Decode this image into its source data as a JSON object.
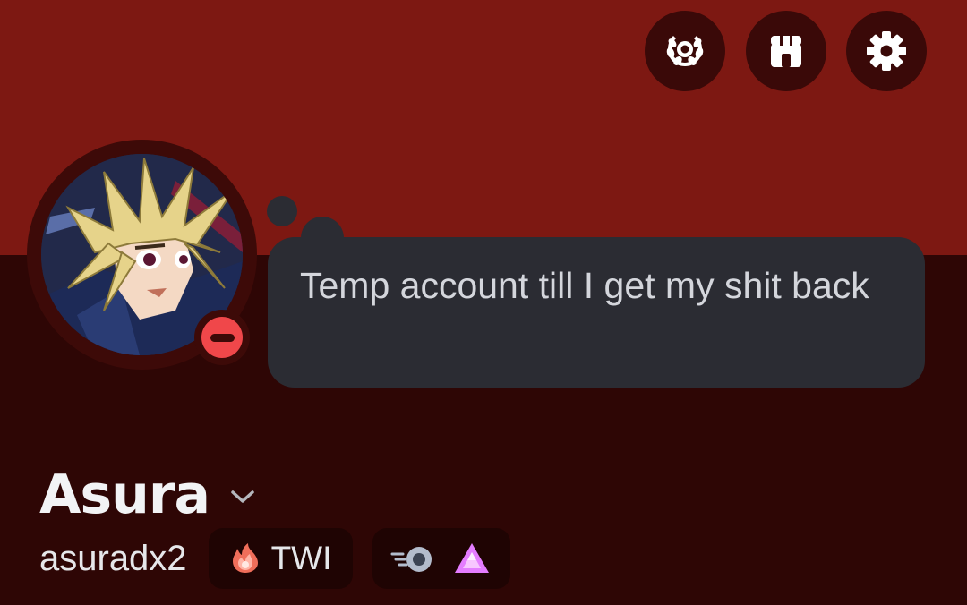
{
  "profile": {
    "custom_status": "Temp account till I get my shit back",
    "display_name": "Asura",
    "username": "asuradx2",
    "status": "do-not-disturb",
    "server_tag": {
      "label": "TWI",
      "icon": "flame-icon"
    },
    "badges": [
      "nitro-badge-icon",
      "server-boost-badge-icon"
    ]
  },
  "header": {
    "buttons": [
      "nitro-icon",
      "shop-icon",
      "settings-icon"
    ]
  },
  "colors": {
    "banner": "#7d1812",
    "profile_background": "#2e0605",
    "status_dnd": "#f0474a",
    "bubble": "#2b2c33",
    "boost_badge": "#e47dff"
  }
}
